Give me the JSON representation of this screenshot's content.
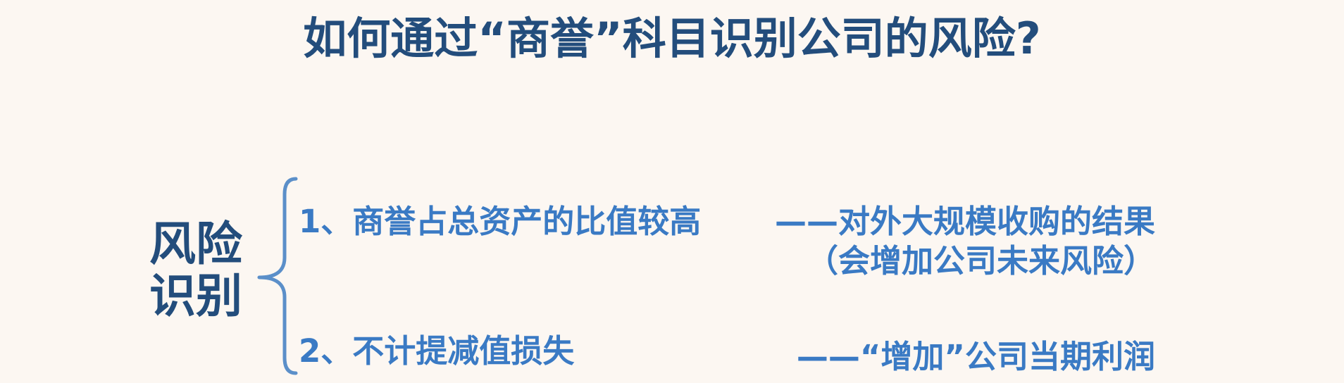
{
  "title": "如何通过“商誉”科目识别公司的风险?",
  "node": {
    "line1": "风险",
    "line2": "识别"
  },
  "items": [
    {
      "label": "1、商誉占总资产的比值较高",
      "note_line1": "——对外大规模收购的结果",
      "note_line2": "（会增加公司未来风险）"
    },
    {
      "label": "2、不计提减值损失",
      "note_line1": "——“增加”公司当期利润"
    }
  ],
  "colors": {
    "background": "#fcf7f2",
    "title": "#234d7c",
    "node": "#234d7c",
    "items": "#3a7ac4",
    "brace": "#5b8fc9"
  }
}
